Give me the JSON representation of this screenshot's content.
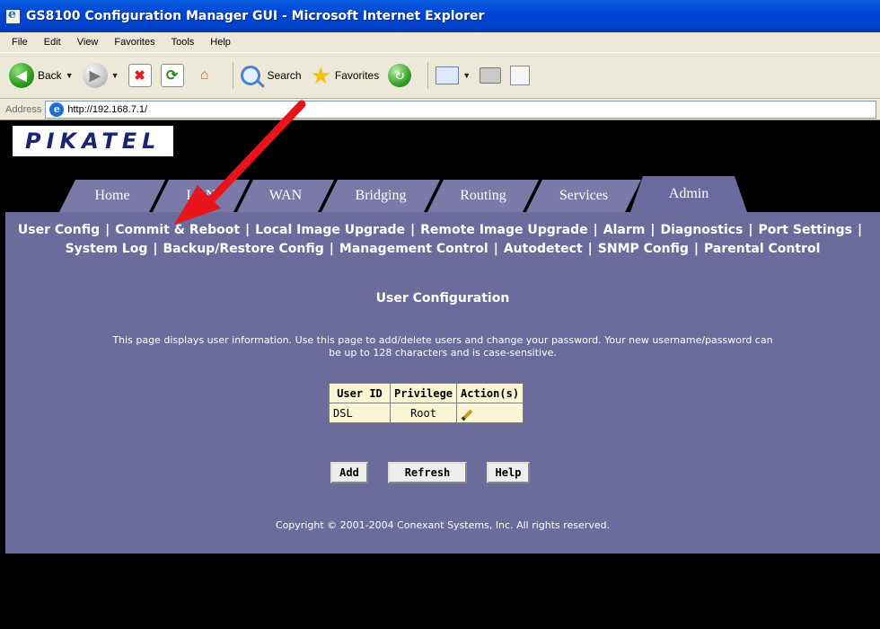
{
  "window": {
    "title": "GS8100 Configuration Manager GUI - Microsoft Internet Explorer"
  },
  "menubar": {
    "items": [
      "File",
      "Edit",
      "View",
      "Favorites",
      "Tools",
      "Help"
    ]
  },
  "toolbar": {
    "back_label": "Back",
    "search_label": "Search",
    "favorites_label": "Favorites"
  },
  "addressbar": {
    "label": "Address",
    "url": "http://192.168.7.1/"
  },
  "brand": {
    "logo_text": "PIKATEL"
  },
  "tabs": [
    {
      "label": "Home"
    },
    {
      "label": "LAN"
    },
    {
      "label": "WAN"
    },
    {
      "label": "Bridging"
    },
    {
      "label": "Routing"
    },
    {
      "label": "Services"
    },
    {
      "label": "Admin",
      "active": true
    }
  ],
  "subnav": {
    "row1": [
      "User Config",
      "Commit & Reboot",
      "Local Image Upgrade",
      "Remote Image Upgrade",
      "Alarm",
      "Diagnostics",
      "Port Settings"
    ],
    "row2": [
      "System Log",
      "Backup/Restore Config",
      "Management Control",
      "Autodetect",
      "SNMP Config",
      "Parental Control"
    ],
    "separator": "|"
  },
  "main": {
    "heading": "User Configuration",
    "description_line1": "This page displays user information. Use this page to add/delete users and change your password. Your new username/password can",
    "description_line2": "be up to 128 characters and is case-sensitive.",
    "table": {
      "headers": [
        "User ID",
        "Privilege",
        "Action(s)"
      ],
      "rows": [
        {
          "user_id": "DSL",
          "privilege": "Root",
          "action_icon": "pencil-icon"
        }
      ]
    },
    "buttons": {
      "add": "Add",
      "refresh": "Refresh",
      "help": "Help"
    },
    "copyright": "Copyright © 2001-2004 Conexant Systems, Inc. All rights reserved."
  },
  "colors": {
    "content_bg": "#6b6b9c",
    "tab_bg": "#7b79a8",
    "table_bg": "#fbf5d4",
    "annotation_arrow": "#e8141c",
    "titlebar": "#0046d5"
  }
}
